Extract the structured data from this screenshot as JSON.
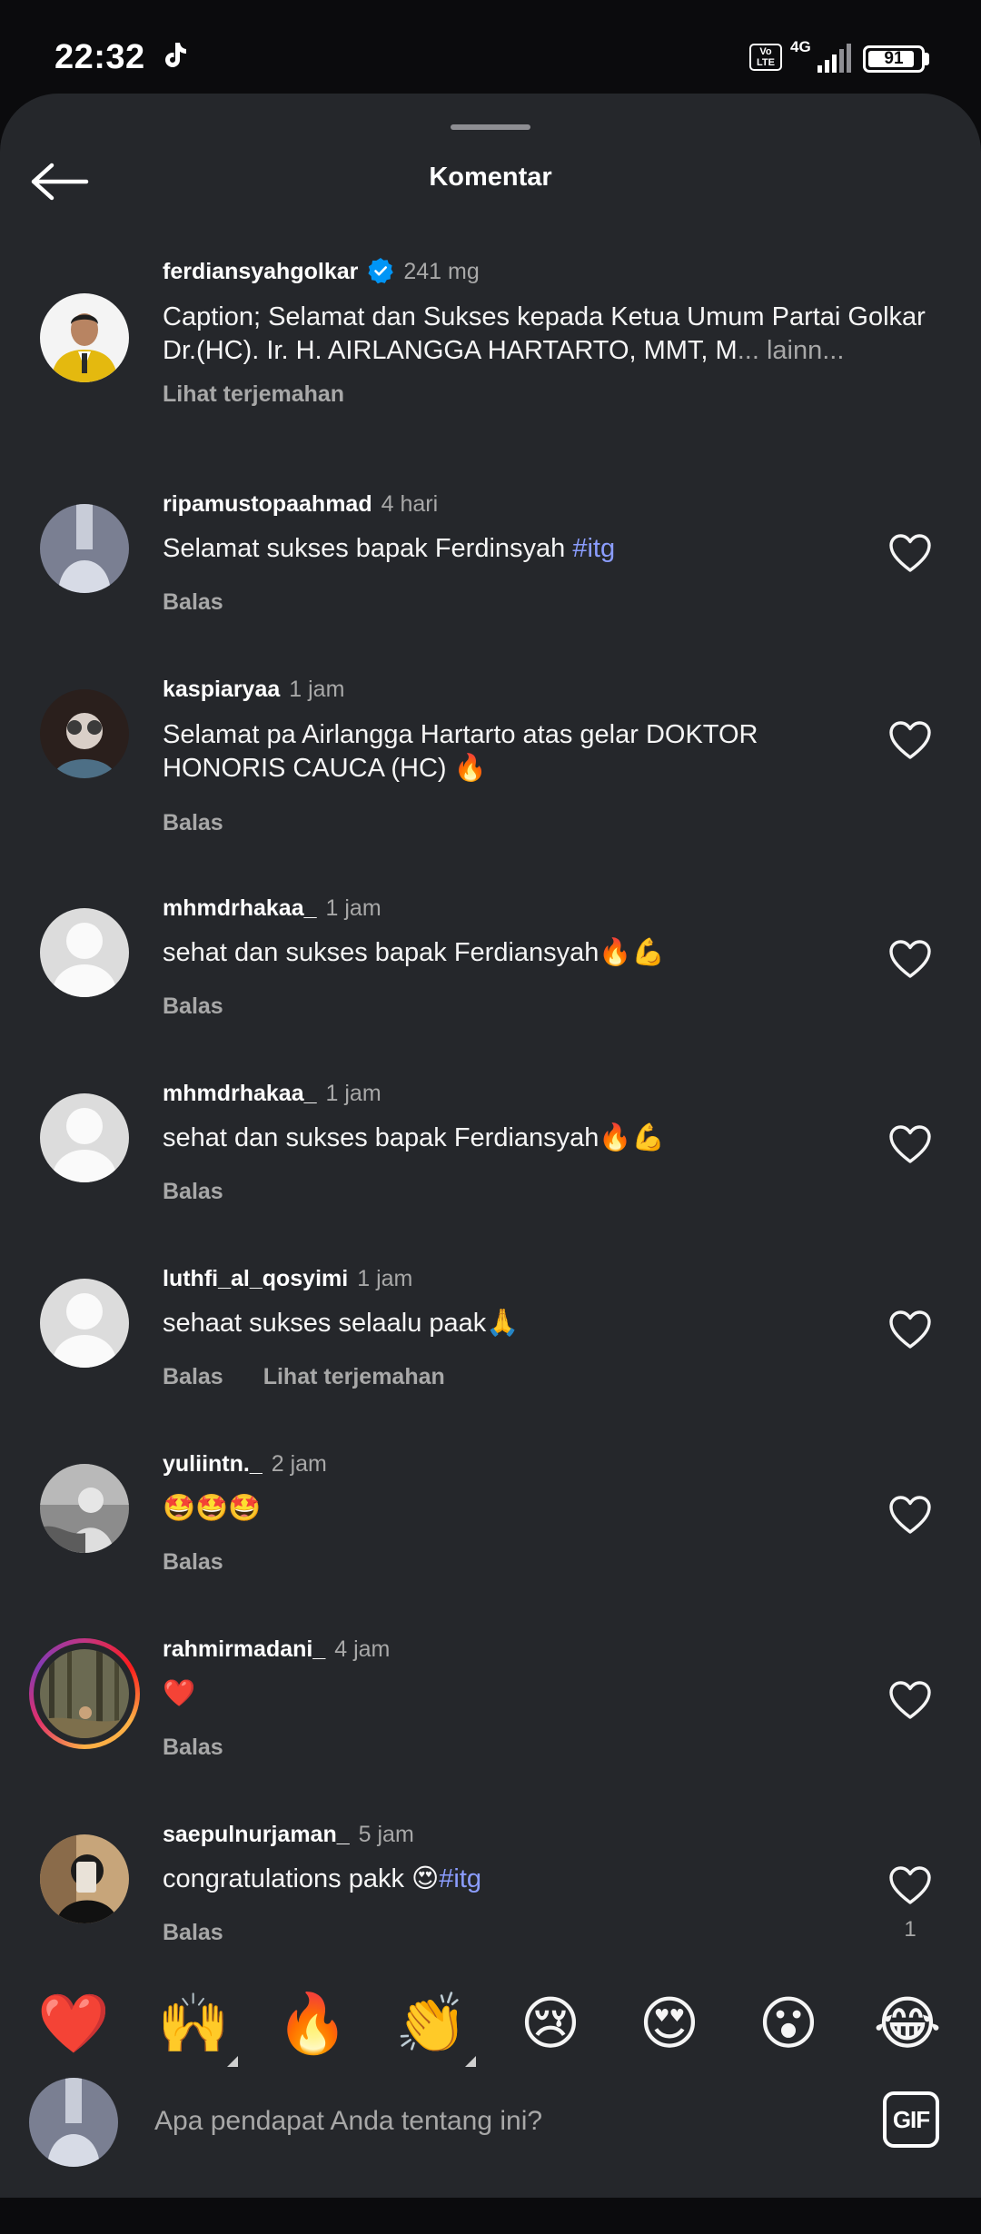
{
  "status_bar": {
    "time": "22:32",
    "app_icon": "tiktok-icon",
    "volte_line1": "Vo",
    "volte_line2": "LTE",
    "network": "4G",
    "battery": "91",
    "battery_level_percent": 91
  },
  "header": {
    "title": "Komentar",
    "back_icon": "arrow-left-icon"
  },
  "caption": {
    "username": "ferdiansyahgolkar",
    "verified": true,
    "time": "241 mg",
    "text": "Caption; Selamat dan Sukses kepada Ketua Umum Partai Golkar Dr.(HC). Ir. H. AIRLANGGA HARTARTO, MMT, M",
    "more": "... lainn...",
    "translate": "Lihat terjemahan"
  },
  "comments": [
    {
      "username": "ripamustopaahmad",
      "time": "4 hari",
      "text": "Selamat sukses bapak Ferdinsyah ",
      "hashtag": "#itg",
      "reply": "Balas"
    },
    {
      "username": "kaspiaryaa",
      "time": "1 jam",
      "text": "Selamat pa Airlangga Hartarto atas gelar DOKTOR HONORIS CAUCA (HC) 🔥",
      "reply": "Balas"
    },
    {
      "username": "mhmdrhakaa_",
      "time": "1 jam",
      "text": "sehat dan sukses bapak Ferdiansyah🔥💪",
      "reply": "Balas"
    },
    {
      "username": "mhmdrhakaa_",
      "time": "1 jam",
      "text": "sehat dan sukses bapak Ferdiansyah🔥💪",
      "reply": "Balas"
    },
    {
      "username": "luthfi_al_qosyimi",
      "time": "1 jam",
      "text": "sehaat sukses selaalu paak🙏",
      "reply": "Balas",
      "translate": "Lihat terjemahan"
    },
    {
      "username": "yuliintn._",
      "time": "2 jam",
      "text": "🤩🤩🤩",
      "reply": "Balas"
    },
    {
      "username": "rahmirmadani_",
      "time": "4 jam",
      "text": "❤️",
      "reply": "Balas"
    },
    {
      "username": "saepulnurjaman_",
      "time": "5 jam",
      "text": "congratulations pakk 😍",
      "hashtag": "#itg",
      "reply": "Balas",
      "likes": "1"
    }
  ],
  "reactions": [
    "❤️",
    "🙌",
    "🔥",
    "👏",
    "😢",
    "😍",
    "😮",
    "😂"
  ],
  "composer": {
    "placeholder": "Apa pendapat Anda tentang ini?",
    "gif_label": "GIF"
  },
  "colors": {
    "sheet_bg": "#25272b",
    "hashtag": "#8b9dff",
    "verified": "#0095f6",
    "muted": "#a8a8a8"
  }
}
